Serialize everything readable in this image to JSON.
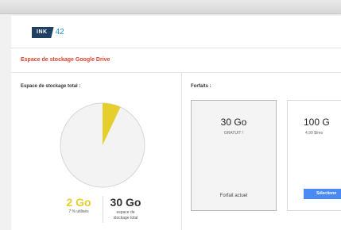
{
  "logo": {
    "brand": "INK",
    "number": "42"
  },
  "page_title": "Espace de stockage Google Drive",
  "storage": {
    "label": "Espace de stockage total :",
    "used_value": "2 Go",
    "used_caption": "7 % utilisés",
    "used_percent": 7,
    "total_value": "30 Go",
    "total_caption_line1": "espace de",
    "total_caption_line2": "stockage total",
    "colors": {
      "used": "#e4cf2c",
      "free": "#f3f3f3",
      "pie_border": "#d6d6d6"
    }
  },
  "plans": {
    "label": "Forfaits :",
    "items": [
      {
        "size": "30 Go",
        "subtitle": "GRATUIT !",
        "status": "Forfait actuel"
      },
      {
        "size": "100 G",
        "subtitle": "4,99 $/mo",
        "button": "Sélectionn"
      }
    ]
  },
  "accent_colors": {
    "title": "#d9422b",
    "button": "#4a8af4",
    "logo": "#1f3f63"
  }
}
